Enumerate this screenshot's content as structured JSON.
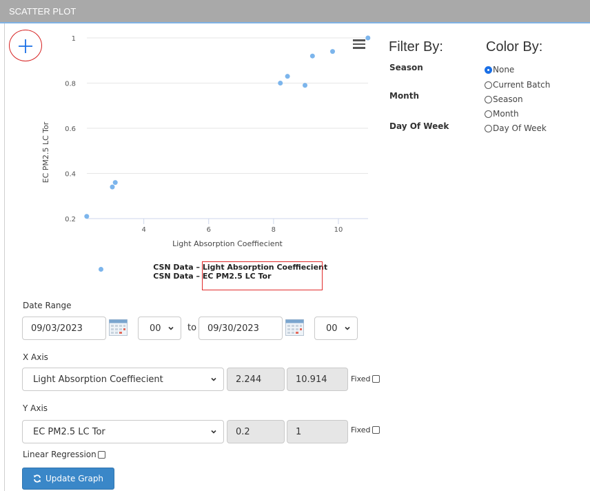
{
  "panel": {
    "title": "SCATTER PLOT"
  },
  "legend": [
    {
      "source": "CSN Data –",
      "name": "Light Absorption Coeffiecient"
    },
    {
      "source": "CSN Data –",
      "name": "EC PM2.5 LC Tor"
    }
  ],
  "filter_by": {
    "title": "Filter By:",
    "labels": [
      "Season",
      "Month",
      "Day Of Week"
    ]
  },
  "color_by": {
    "title": "Color By:",
    "options": [
      "None",
      "Current Batch",
      "Season",
      "Month",
      "Day Of Week"
    ],
    "selected": "None"
  },
  "date_range": {
    "label": "Date Range",
    "start": "09/03/2023",
    "start_hour": "00",
    "to": "to",
    "end": "09/30/2023",
    "end_hour": "00"
  },
  "x_axis": {
    "label": "X Axis",
    "variable": "Light Absorption Coeffiecient",
    "min": "2.244",
    "max": "10.914",
    "fixed_label": "Fixed"
  },
  "y_axis": {
    "label": "Y Axis",
    "variable": "EC PM2.5 LC Tor",
    "min": "0.2",
    "max": "1",
    "fixed_label": "Fixed"
  },
  "linear_regression": {
    "label": "Linear Regression"
  },
  "update_button": {
    "label": "Update Graph"
  },
  "colors": {
    "point": "#7cb5ec",
    "header": "#a9a9a9",
    "accent": "#1a6fe6",
    "highlight": "#e12a2a",
    "button": "#3a87c8"
  },
  "chart_data": {
    "type": "scatter",
    "xlabel": "Light Absorption Coeffiecient",
    "ylabel": "EC PM2.5 LC Tor",
    "xlim": [
      2.244,
      10.914
    ],
    "ylim": [
      0.2,
      1.0
    ],
    "xticks": [
      4,
      6,
      8,
      10
    ],
    "yticks": [
      0.2,
      0.4,
      0.6,
      0.8,
      1
    ],
    "grid": true,
    "series": [
      {
        "points": [
          [
            2.24,
            0.21
          ],
          [
            3.03,
            0.34
          ],
          [
            3.12,
            0.36
          ],
          [
            8.21,
            0.8
          ],
          [
            8.43,
            0.83
          ],
          [
            8.97,
            0.79
          ],
          [
            9.2,
            0.92
          ],
          [
            9.82,
            0.94
          ],
          [
            10.91,
            1.0
          ]
        ]
      }
    ]
  }
}
